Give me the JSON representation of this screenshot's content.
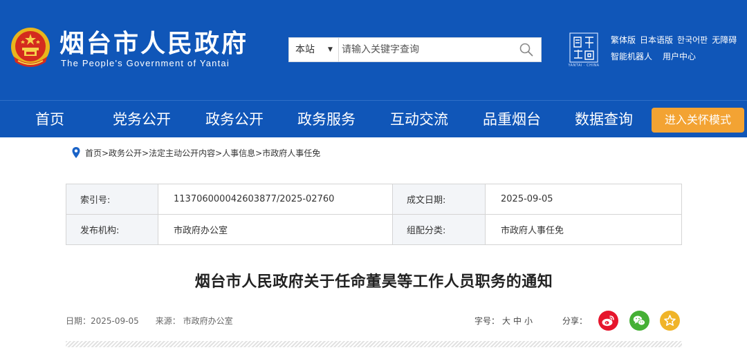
{
  "header": {
    "title": "烟台市人民政府",
    "subtitle": "The People's Government of Yantai",
    "search": {
      "scope": "本站",
      "placeholder": "请输入关键字查询"
    },
    "brand_logo_text": "YANTAI · CHINA",
    "util_links": [
      "繁体版",
      "日本语版",
      "한국어판",
      "无障碍"
    ],
    "util_links_row2": [
      "智能机器人",
      "用户中心"
    ]
  },
  "nav": {
    "items": [
      "首页",
      "党务公开",
      "政务公开",
      "政务服务",
      "互动交流",
      "品重烟台",
      "数据查询"
    ],
    "care_mode": "进入关怀模式"
  },
  "breadcrumb": "首页>政务公开>法定主动公开内容>人事信息>市政府人事任免",
  "info": {
    "index_label": "索引号:",
    "index_value": "113706000042603877/2025-02760",
    "date_label": "成文日期:",
    "date_value": "2025-09-05",
    "org_label": "发布机构:",
    "org_value": "市政府办公室",
    "category_label": "组配分类:",
    "category_value": "市政府人事任免"
  },
  "article": {
    "title": "烟台市人民政府关于任命董昊等工作人员职务的通知",
    "date": "日期：2025-09-05",
    "source": "来源： 市政府办公室",
    "fontsize_label": "字号：",
    "fontsize_options": [
      "大",
      "中",
      "小"
    ],
    "share_label": "分享："
  },
  "colors": {
    "header_blue": "#1056b8",
    "care_orange": "#f3a333",
    "weibo_red": "#e6162d",
    "wechat_green": "#45b035",
    "favorite_yellow": "#f0b429"
  }
}
